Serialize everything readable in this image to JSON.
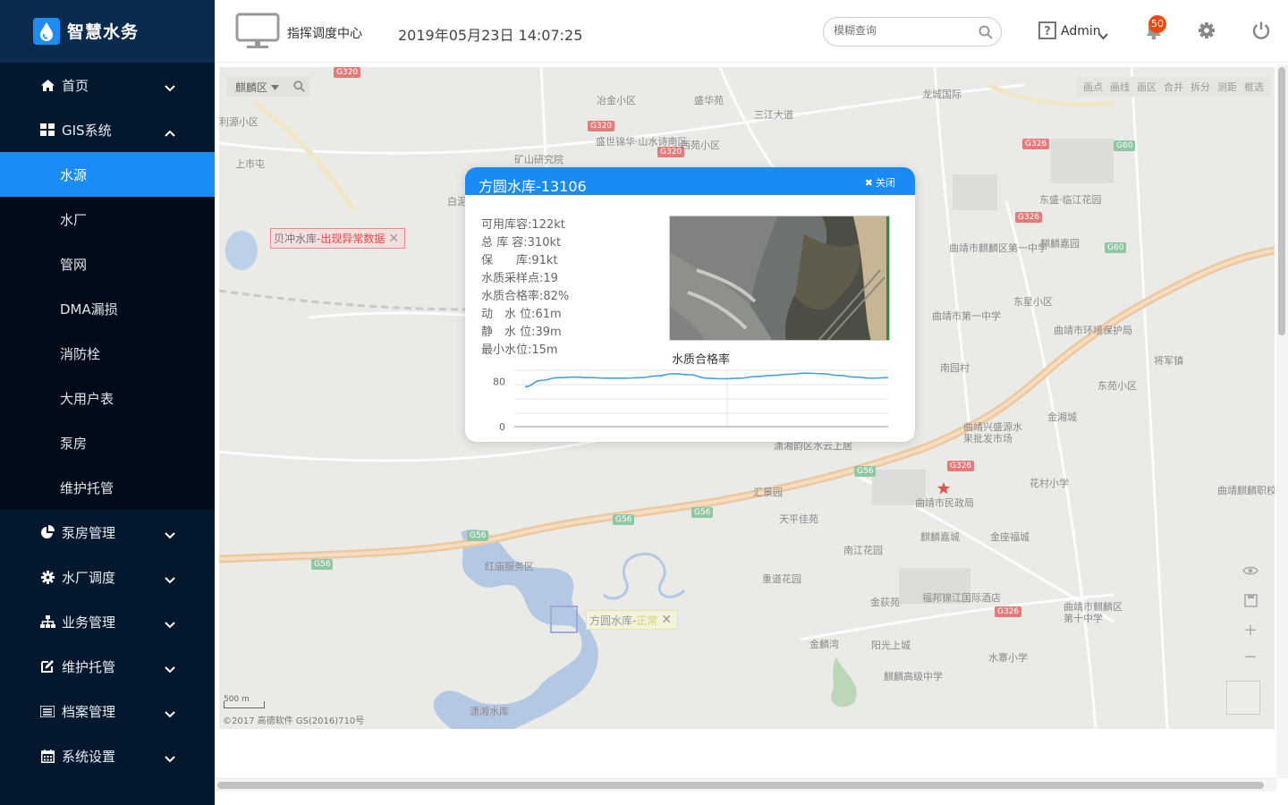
{
  "app": {
    "title": "智慧水务",
    "logo_icon": "water-drop-icon"
  },
  "sidebar": {
    "items": [
      {
        "label": "首页",
        "icon": "home-icon",
        "expanded": false
      },
      {
        "label": "GIS系统",
        "icon": "grid-icon",
        "expanded": true,
        "children": [
          {
            "label": "水源",
            "active": true
          },
          {
            "label": "水厂"
          },
          {
            "label": "管网"
          },
          {
            "label": "DMA漏损"
          },
          {
            "label": "消防栓"
          },
          {
            "label": "大用户表"
          },
          {
            "label": "泵房"
          },
          {
            "label": "维护托管"
          }
        ]
      },
      {
        "label": "泵房管理",
        "icon": "pie-chart-icon",
        "expanded": false
      },
      {
        "label": "水厂调度",
        "icon": "gear-icon",
        "expanded": false
      },
      {
        "label": "业务管理",
        "icon": "sitemap-icon",
        "expanded": false
      },
      {
        "label": "维护托管",
        "icon": "edit-icon",
        "expanded": false
      },
      {
        "label": "档案管理",
        "icon": "list-icon",
        "expanded": false
      },
      {
        "label": "系统设置",
        "icon": "calendar-icon",
        "expanded": false
      }
    ]
  },
  "header": {
    "center_label": "指挥调度中心",
    "datetime": "2019年05月23日 14:07:25",
    "search_placeholder": "模糊查询",
    "user": "Admin",
    "notification_count": "50"
  },
  "map": {
    "district": "麒麟区",
    "tools": [
      "画点",
      "画线",
      "画区",
      "合并",
      "拆分",
      "测距",
      "框选"
    ],
    "scale_label": "500 m",
    "copyright": "©2017 高德软件 GS(2016)710号",
    "alarm_tag": {
      "name": "贝冲水库-",
      "status": "出现异常数据"
    },
    "normal_tag": {
      "name": "方圆水库-",
      "status": "正常"
    },
    "labels": [
      "冶金小区",
      "盛华苑",
      "三江大道",
      "龙城国际",
      "盛世锦华·山水诗南区",
      "西苑小区",
      "矿山研究院",
      "白泥",
      "曲靖市麒麟区第一中学",
      "麒麟嘉园",
      "东盛·临江花园",
      "东星小区",
      "曲靖市第一中学",
      "曲靖市环境保护局",
      "南园村",
      "将军镇",
      "东苑小区",
      "金湘城",
      "曲靖兴盛源水果批发市场",
      "潇湘韵区水云上居",
      "花村小学",
      "曲靖市民政局",
      "汇景园",
      "天平佳苑",
      "南江花园",
      "麒麟嘉城",
      "金座福城",
      "红庙服务区",
      "重道花园",
      "金荻苑",
      "福邦锦江国际酒店",
      "曲靖市麒麟区第十中学",
      "金麟湾",
      "阳光上城",
      "水寨小学",
      "麒麟高级中学",
      "潇湘水库",
      "曲靖麒麟职校",
      "上市屯",
      "利源小区"
    ]
  },
  "popup": {
    "title": "方圆水库-13106",
    "close_label": "关闭",
    "stats": [
      {
        "label": "可用库容:",
        "value": "122kt"
      },
      {
        "label": "总 库 容:",
        "value": "310kt"
      },
      {
        "label": "保　　库:",
        "value": "91kt"
      },
      {
        "label": "水质采样点:",
        "value": "19"
      },
      {
        "label": "水质合格率:",
        "value": "82%"
      },
      {
        "label": "动　水 位:",
        "value": "61m"
      },
      {
        "label": "静　水 位:",
        "value": "39m"
      },
      {
        "label": "最小水位:",
        "value": "15m"
      }
    ],
    "photo_alt": "水库现场图片"
  },
  "chart_data": {
    "type": "line",
    "title": "水质合格率",
    "ylim": [
      0,
      100
    ],
    "yticks": [
      "80",
      "0"
    ],
    "series": [
      {
        "values": [
          71,
          82,
          87,
          88,
          87,
          86,
          86,
          87,
          90,
          94,
          92,
          86,
          85,
          86,
          89,
          91,
          93,
          95,
          94,
          91,
          88,
          86,
          87
        ]
      }
    ],
    "colors": {
      "line": "#4a9ee8"
    }
  }
}
